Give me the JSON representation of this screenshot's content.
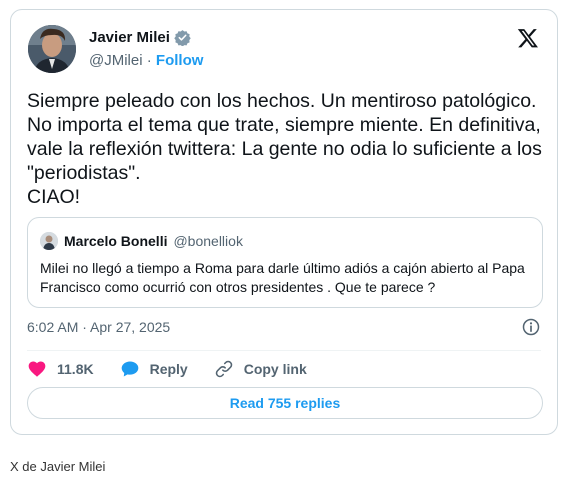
{
  "author": {
    "name": "Javier Milei",
    "handle": "@JMilei",
    "separator": " · ",
    "follow_label": "Follow",
    "verified": true,
    "verified_color": "#829aab"
  },
  "tweet": {
    "text": "Siempre peleado con los hechos. Un mentiroso patológico. No importa el tema que trate, siempre miente. En definitiva, vale la reflexión twittera: La gente no odia lo suficiente a los \"periodistas\".\nCIAO!",
    "timestamp": "6:02 AM · Apr 27, 2025"
  },
  "quoted": {
    "name": "Marcelo Bonelli",
    "handle": "@bonelliok",
    "text": "Milei no llegó a tiempo a Roma para darle último adiós a cajón abierto al Papa Francisco como ocurrió con otros presidentes . Que te parece ?"
  },
  "actions": {
    "likes": "11.8K",
    "reply_label": "Reply",
    "copy_label": "Copy link"
  },
  "read_replies_label": "Read 755 replies",
  "caption": "X de Javier Milei",
  "icons": {
    "platform": "x-logo-icon",
    "verified": "verified-badge-icon",
    "info": "info-icon",
    "like": "heart-icon",
    "reply": "reply-bubble-icon",
    "copy": "link-icon"
  },
  "colors": {
    "accent": "#1d9bf0",
    "heart": "#f91880",
    "muted": "#536471",
    "border": "#cfd9de"
  }
}
